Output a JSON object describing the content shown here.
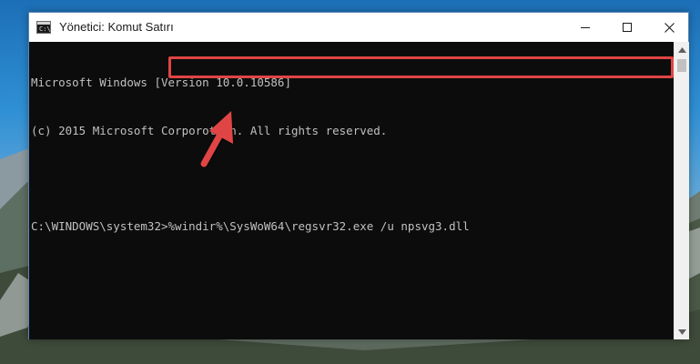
{
  "window": {
    "title": "Yönetici: Komut Satırı",
    "icon": "cmd-icon",
    "icon_text": "C:\\."
  },
  "controls": {
    "minimize": "minimize-icon",
    "maximize": "maximize-icon",
    "close": "close-icon"
  },
  "console": {
    "lines": [
      "Microsoft Windows [Version 10.0.10586]",
      "(c) 2015 Microsoft Corporotion. All rights reserved.",
      ""
    ],
    "prompt": "C:\\WINDOWS\\system32>",
    "command": "%windir%\\SysWoW64\\regsvr32.exe /u npsvg3.dll",
    "text_color": "#c0c0c0",
    "background": "#0c0c0c"
  },
  "annotation": {
    "highlight_color": "#e04444",
    "arrow_color": "#e04444"
  }
}
